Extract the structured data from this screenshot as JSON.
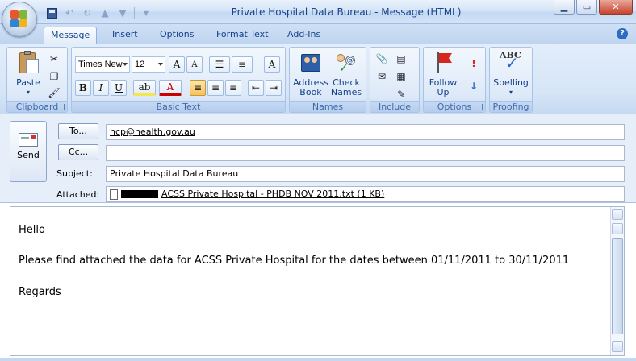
{
  "window": {
    "title": "Private Hospital Data Bureau - Message (HTML)"
  },
  "tabs": [
    {
      "label": "Message",
      "active": true
    },
    {
      "label": "Insert",
      "active": false
    },
    {
      "label": "Options",
      "active": false
    },
    {
      "label": "Format Text",
      "active": false
    },
    {
      "label": "Add-Ins",
      "active": false
    }
  ],
  "ribbon": {
    "clipboard": {
      "label": "Clipboard",
      "paste": "Paste"
    },
    "basic_text": {
      "label": "Basic Text",
      "font": "Times New",
      "size": "12"
    },
    "names": {
      "label": "Names",
      "address_book_1": "Address",
      "address_book_2": "Book",
      "check_names_1": "Check",
      "check_names_2": "Names"
    },
    "include": {
      "label": "Include"
    },
    "options": {
      "label": "Options",
      "follow_up_1": "Follow",
      "follow_up_2": "Up"
    },
    "proofing": {
      "label": "Proofing",
      "spelling": "Spelling",
      "abc": "ABC"
    }
  },
  "header": {
    "send_label": "Send",
    "to_button": "To...",
    "cc_button": "Cc...",
    "to_value": "hcp@health.gov.au",
    "cc_value": "",
    "subject_label": "Subject:",
    "subject_value": "Private Hospital Data Bureau",
    "attached_label": "Attached:",
    "attachment_name": "ACSS Private Hospital - PHDB NOV 2011.txt (1 KB)"
  },
  "body": {
    "line1": "Hello",
    "line2": "Please find attached the data for ACSS Private Hospital for the dates between 01/11/2011 to 30/11/2011",
    "line3": "Regards"
  },
  "colors": {
    "accent": "#15428b",
    "ribbon": "#dde9f8",
    "close": "#c5452f"
  }
}
